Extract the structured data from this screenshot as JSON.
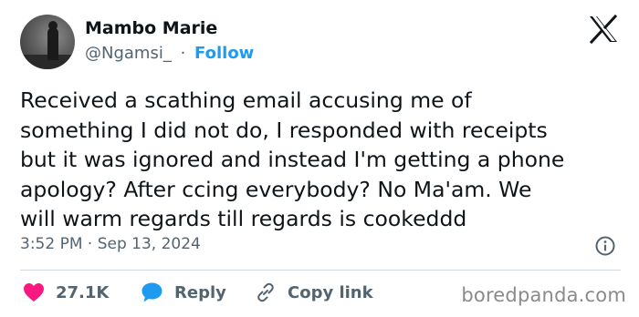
{
  "author": {
    "display_name": "Mambo Marie",
    "handle": "@Ngamsi_",
    "separator": "·",
    "follow_label": "Follow"
  },
  "tweet": {
    "text": "Received a scathing email accusing me of\nsomething I did not do, I responded with receipts\nbut it was ignored and instead I'm getting a phone\napology? After ccing everybody? No Ma'am. We\nwill warm regards till regards is cookeddd",
    "timestamp": "3:52 PM · Sep 13, 2024"
  },
  "actions": {
    "likes_count": "27.1K",
    "reply_label": "Reply",
    "copy_link_label": "Copy link"
  },
  "watermark": "boredpanda.com",
  "icons": {
    "logo": "x-logo-icon",
    "info": "info-icon",
    "like": "heart-icon",
    "reply": "speech-bubble-icon",
    "copy_link": "link-icon"
  },
  "colors": {
    "like": "#f91880",
    "reply": "#1d9bf0",
    "follow": "#1d9bf0",
    "text": "#0f1419",
    "secondary": "#536471"
  }
}
